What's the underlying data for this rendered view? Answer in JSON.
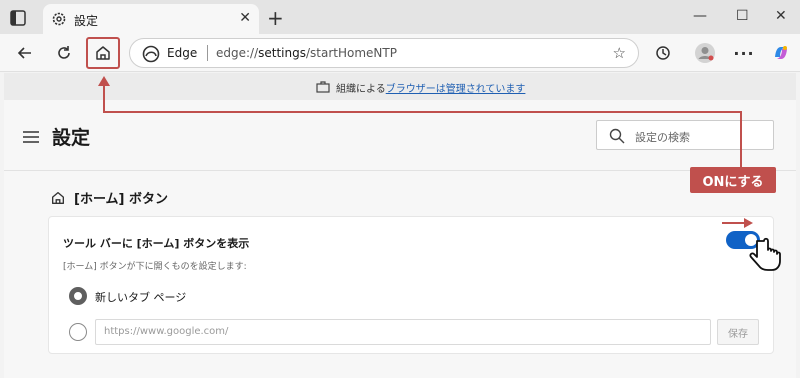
{
  "tab": {
    "title": "設定"
  },
  "address": {
    "browser_label": "Edge",
    "url_prefix": "edge://",
    "url_strong": "settings",
    "url_rest": "/startHomeNTP"
  },
  "banner": {
    "prefix": "組織による",
    "link": "ブラウザーは管理されています"
  },
  "page": {
    "title": "設定",
    "search_placeholder": "設定の検索",
    "section_title": "[ホーム] ボタン",
    "toggle_label": "ツール バーに [ホーム] ボタンを表示",
    "description": "[ホーム] ボタンが下に開くものを設定します:",
    "option_newtab": "新しいタブ ページ",
    "url_placeholder": "https://www.google.com/",
    "save_label": "保存",
    "toggle_on": true
  },
  "annotation": {
    "label": "ONにする"
  },
  "icons": [
    "tab-actions-icon",
    "gear-icon",
    "close-icon",
    "plus-icon",
    "minimize-icon",
    "maximize-icon",
    "back-icon",
    "refresh-icon",
    "home-icon",
    "edge-logo-icon",
    "star-icon",
    "history-icon",
    "profile-icon",
    "more-icon",
    "copilot-icon",
    "lock-icon",
    "menu-icon",
    "search-icon",
    "pointer-hand-icon"
  ],
  "colors": {
    "accent": "#1062c6",
    "annotation": "#c0504d"
  }
}
